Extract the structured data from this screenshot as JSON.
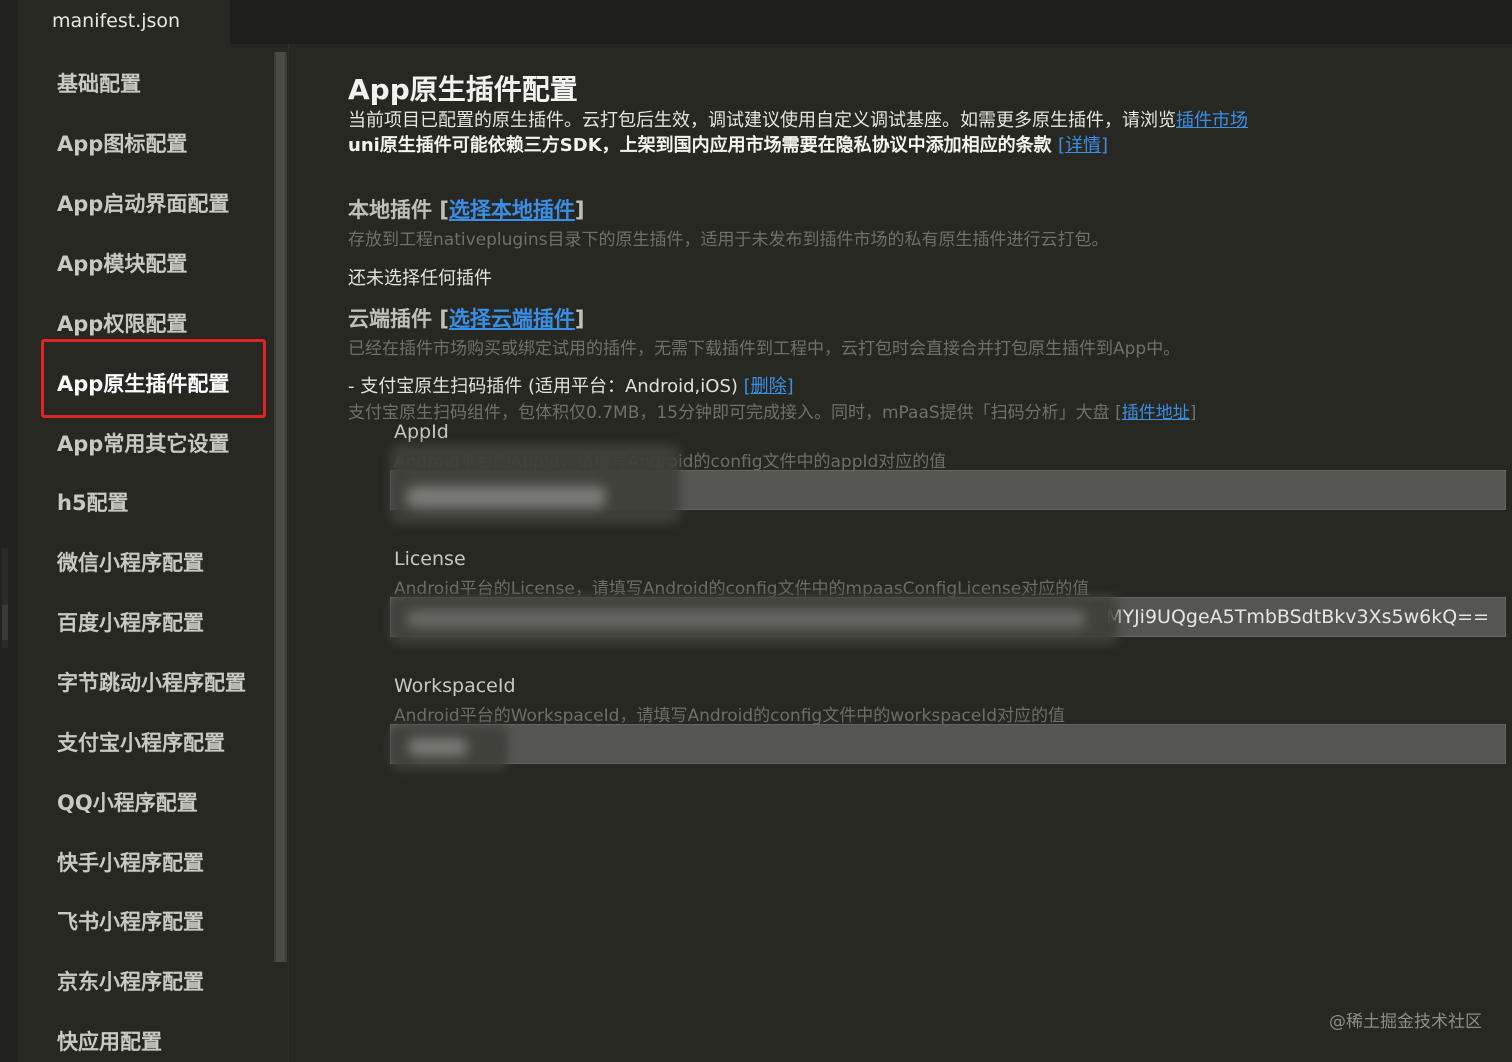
{
  "tab": {
    "label": "manifest.json"
  },
  "sidebar": {
    "items": [
      {
        "label": "基础配置"
      },
      {
        "label": "App图标配置"
      },
      {
        "label": "App启动界面配置"
      },
      {
        "label": "App模块配置"
      },
      {
        "label": "App权限配置"
      },
      {
        "label": "App原生插件配置"
      },
      {
        "label": "App常用其它设置"
      },
      {
        "label": "h5配置"
      },
      {
        "label": "微信小程序配置"
      },
      {
        "label": "百度小程序配置"
      },
      {
        "label": "字节跳动小程序配置"
      },
      {
        "label": "支付宝小程序配置"
      },
      {
        "label": "QQ小程序配置"
      },
      {
        "label": "快手小程序配置"
      },
      {
        "label": "飞书小程序配置"
      },
      {
        "label": "京东小程序配置"
      },
      {
        "label": "快应用配置"
      }
    ],
    "active_index": 5
  },
  "main": {
    "title": "App原生插件配置",
    "desc1": "当前项目已配置的原生插件。云打包后生效，调试建议使用自定义调试基座。如需更多原生插件，请浏览",
    "desc1_link": "插件市场",
    "desc2": "uni原生插件可能依赖三方SDK，上架到国内应用市场需要在隐私协议中添加相应的条款",
    "desc2_link": "[详情]",
    "local": {
      "title": "本地插件",
      "bracket_open": "[",
      "link": "选择本地插件",
      "bracket_close": "]",
      "desc": "存放到工程nativeplugins目录下的原生插件，适用于未发布到插件市场的私有原生插件进行云打包。",
      "empty": "还未选择任何插件"
    },
    "cloud": {
      "title": "云端插件",
      "bracket_open": "[",
      "link": "选择云端插件",
      "bracket_close": "]",
      "desc": "已经在插件市场购买或绑定试用的插件，无需下载插件到工程中，云打包时会直接合并打包原生插件到App中。",
      "plugin_name": "- 支付宝原生扫码插件 (适用平台：Android,iOS) ",
      "delete_link": "[删除]",
      "plugin_desc": "支付宝原生扫码组件，包体积仅0.7MB，15分钟即可完成接入。同时，mPaaS提供「扫码分析」大盘 [",
      "plugin_desc_link": "插件地址",
      "plugin_desc_end": "]"
    },
    "fields": {
      "appid": {
        "label": "AppId",
        "hint": "Android平台的AppId，请填写Android的config文件中的appId对应的值",
        "value": ""
      },
      "license": {
        "label": "License",
        "hint": "Android平台的License，请填写Android的config文件中的mpaasConfigLicense对应的值",
        "value": "MYJi9UQgeA5TmbBSdtBkv3Xs5w6kQ=="
      },
      "workspace": {
        "label": "WorkspaceId",
        "hint": "Android平台的WorkspaceId，请填写Android的config文件中的workspaceId对应的值",
        "value": ""
      }
    }
  },
  "watermark": "@稀土掘金技术社区"
}
